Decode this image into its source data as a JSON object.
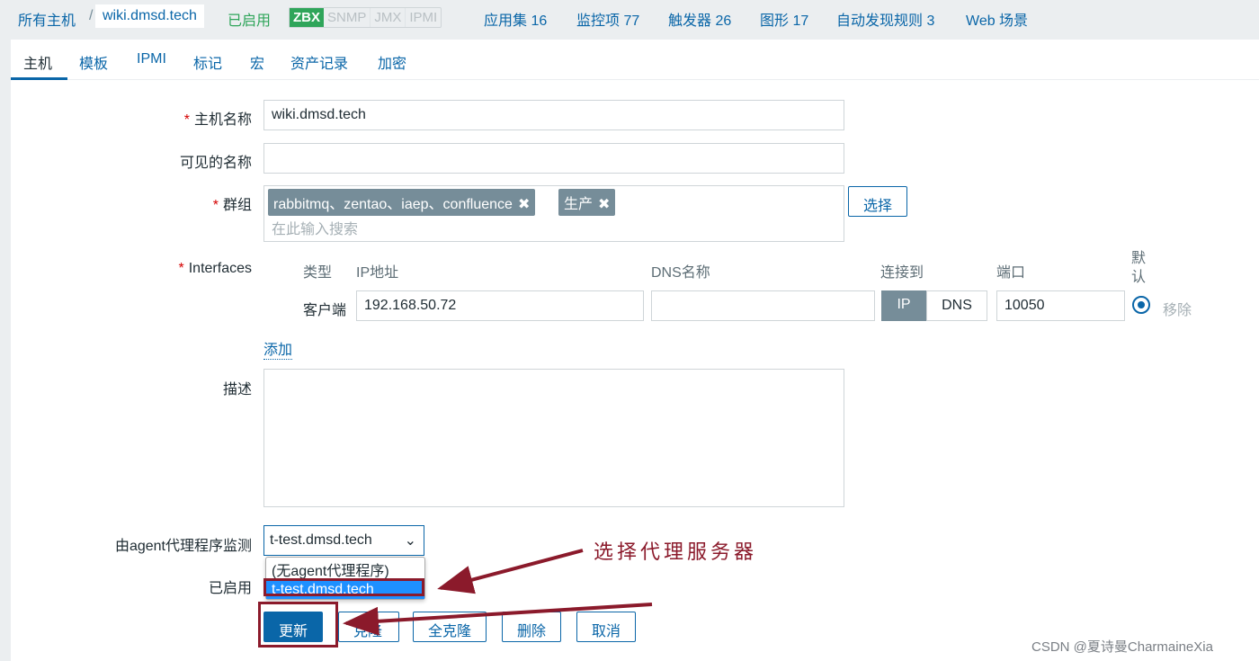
{
  "breadcrumb": {
    "all_hosts": "所有主机",
    "sep": "/",
    "current": "wiki.dmsd.tech"
  },
  "host_status": "已启用",
  "availability": [
    "ZBX",
    "SNMP",
    "JMX",
    "IPMI"
  ],
  "nav_links": [
    "应用集 16",
    "监控项 77",
    "触发器 26",
    "图形 17",
    "自动发现规则 3",
    "Web 场景"
  ],
  "tabs": [
    "主机",
    "模板",
    "IPMI",
    "标记",
    "宏",
    "资产记录",
    "加密"
  ],
  "form": {
    "host_name_label": "主机名称",
    "host_name_value": "wiki.dmsd.tech",
    "visible_name_label": "可见的名称",
    "visible_name_value": "",
    "groups_label": "群组",
    "groups": [
      "rabbitmq、zentao、iaep、confluence",
      "生产"
    ],
    "groups_placeholder": "在此输入搜索",
    "select_button": "选择",
    "interfaces_label": "Interfaces",
    "iface_headers": {
      "type": "类型",
      "ip": "IP地址",
      "dns": "DNS名称",
      "connect": "连接到",
      "port": "端口",
      "default": "默认"
    },
    "iface": {
      "type": "客户端",
      "ip": "192.168.50.72",
      "dns": "",
      "ip_btn": "IP",
      "dns_btn": "DNS",
      "port": "10050",
      "remove": "移除"
    },
    "add_link": "添加",
    "description_label": "描述",
    "description_value": "",
    "proxy_label": "由agent代理程序监测",
    "proxy_value": "t-test.dmsd.tech",
    "proxy_options": [
      "(无agent代理程序)",
      "t-test.dmsd.tech"
    ],
    "enabled_label": "已启用"
  },
  "buttons": [
    "更新",
    "克隆",
    "全克隆",
    "删除",
    "取消"
  ],
  "annotation": "选择代理服务器",
  "watermark": "CSDN @夏诗曼CharmaineXia",
  "colors": {
    "accent": "#0a66a8",
    "annotation": "#8b1a2b",
    "enabled": "#2fa55a"
  }
}
